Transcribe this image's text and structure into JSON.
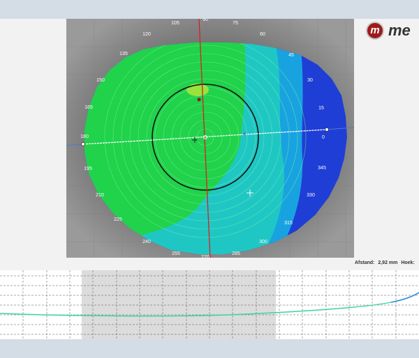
{
  "logo": {
    "mark": "m",
    "text": "me"
  },
  "topography": {
    "angle_labels": [
      "90",
      "105",
      "75",
      "120",
      "60",
      "135",
      "45",
      "150",
      "30",
      "165",
      "15",
      "180",
      "0",
      "195",
      "345",
      "210",
      "330",
      "225",
      "315",
      "240",
      "300",
      "255",
      "285",
      "270"
    ]
  },
  "readout": {
    "distance_label": "Afstand:",
    "distance_value": "2,92 mm",
    "angle_label": "Hoek:"
  },
  "colors": {
    "map_green": "#21d24b",
    "map_teal": "#1fc7c4",
    "map_blue": "#1f3ed6",
    "meridian_red": "#d92020",
    "profile_line": "#3ad2a6"
  }
}
